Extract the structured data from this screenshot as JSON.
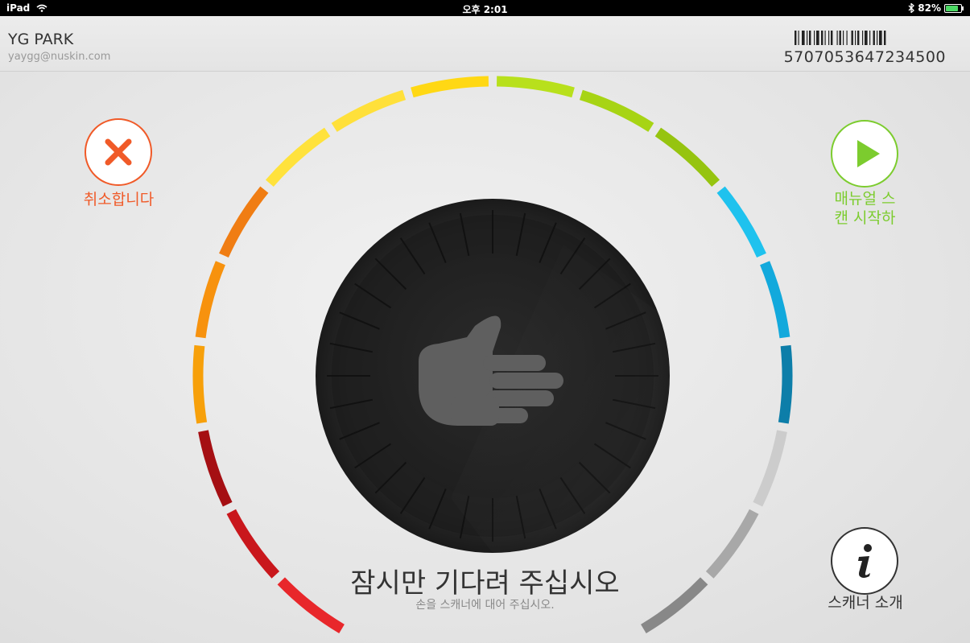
{
  "status_bar": {
    "device": "iPad",
    "time": "오후 2:01",
    "battery_text": "82%",
    "battery_level": 0.82
  },
  "header": {
    "user_name": "YG PARK",
    "user_email": "yaygg@nuskin.com",
    "barcode_number": "5707053647234500"
  },
  "actions": {
    "cancel_label": "취소합니다",
    "manual_scan_label_line1": "매뉴얼 스",
    "manual_scan_label_line2": "캔 시작하",
    "scanner_intro_label": "스캐너 소개"
  },
  "scanner": {
    "title": "잠시만 기다려 주십시오",
    "subtitle": "손을 스캐너에 대어 주십시오.",
    "gauge_colors": [
      "#e8272b",
      "#c9171c",
      "#a50f13",
      "#f7a00a",
      "#f7920e",
      "#f07d13",
      "#ffe23c",
      "#ffe03a",
      "#ffd814",
      "#b8e01c",
      "#a7d414",
      "#96c40f",
      "#1fc2ee",
      "#12a9dc",
      "#0d7ea9",
      "#cccccc",
      "#a8a8a8",
      "#888888"
    ],
    "accent_cancel": "#f05a28",
    "accent_manual": "#7ccc2e"
  },
  "icons": {
    "cancel": "close-x-icon",
    "manual": "play-icon",
    "info": "info-icon",
    "scanner": "hand-icon"
  }
}
